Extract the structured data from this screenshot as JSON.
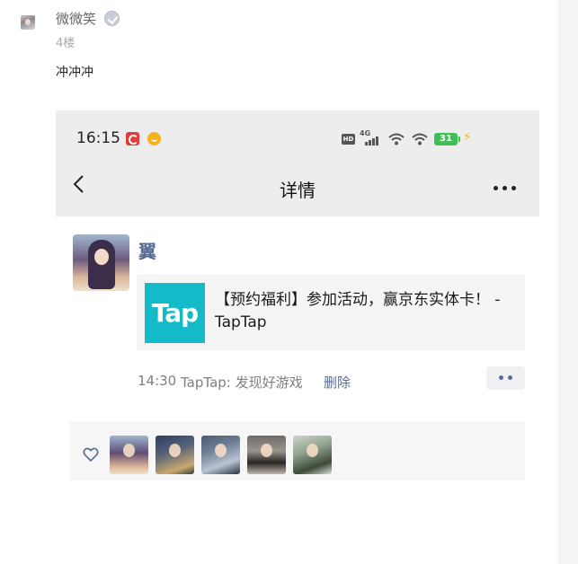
{
  "comment": {
    "username": "微微笑",
    "floor": "4楼",
    "text": "冲冲冲"
  },
  "screenshot": {
    "status_bar": {
      "time": "16:15",
      "network_label": "4G",
      "hd_label": "HD",
      "battery": "31"
    },
    "nav": {
      "title": "详情"
    },
    "post": {
      "author": "翼",
      "link_card": {
        "logo_text": "Tap",
        "title": "【预约福利】参加活动，赢京东实体卡！ - TapTap",
        "logo_color": "#13bac8"
      },
      "time": "14:30",
      "source": "TapTap: 发现好游戏",
      "delete_label": "删除"
    },
    "likes": {
      "count_shown": 5
    }
  },
  "colors": {
    "link_blue": "#576b95",
    "header_bg": "#ededed",
    "battery_green": "#3ec154"
  }
}
